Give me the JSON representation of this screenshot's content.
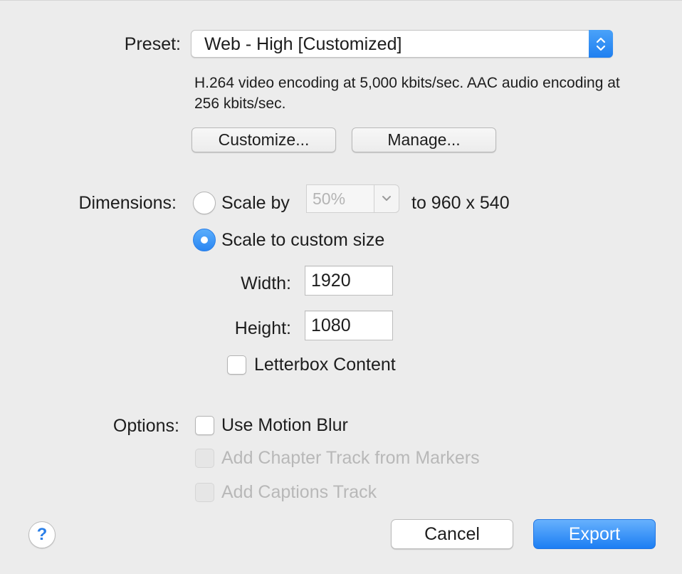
{
  "preset": {
    "label": "Preset:",
    "value": "Web - High [Customized]",
    "description": "H.264 video encoding at 5,000 kbits/sec.  AAC audio encoding at 256 kbits/sec.",
    "customize_label": "Customize...",
    "manage_label": "Manage..."
  },
  "dimensions": {
    "label": "Dimensions:",
    "scale_by_label": "Scale by",
    "scale_by_value": "50%",
    "scale_by_result": "to 960 x 540",
    "scale_by_selected": false,
    "custom_size_label": "Scale to custom size",
    "custom_size_selected": true,
    "width_label": "Width:",
    "width_value": "1920",
    "height_label": "Height:",
    "height_value": "1080",
    "letterbox_label": "Letterbox Content",
    "letterbox_checked": false
  },
  "options": {
    "label": "Options:",
    "motion_blur_label": "Use Motion Blur",
    "motion_blur_checked": false,
    "chapter_track_label": "Add Chapter Track from Markers",
    "chapter_track_enabled": false,
    "captions_track_label": "Add Captions Track",
    "captions_track_enabled": false
  },
  "footer": {
    "help_label": "?",
    "cancel_label": "Cancel",
    "export_label": "Export"
  },
  "colors": {
    "accent": "#2a86f2",
    "background": "#ececec",
    "disabled_text": "#b8b8b8"
  }
}
